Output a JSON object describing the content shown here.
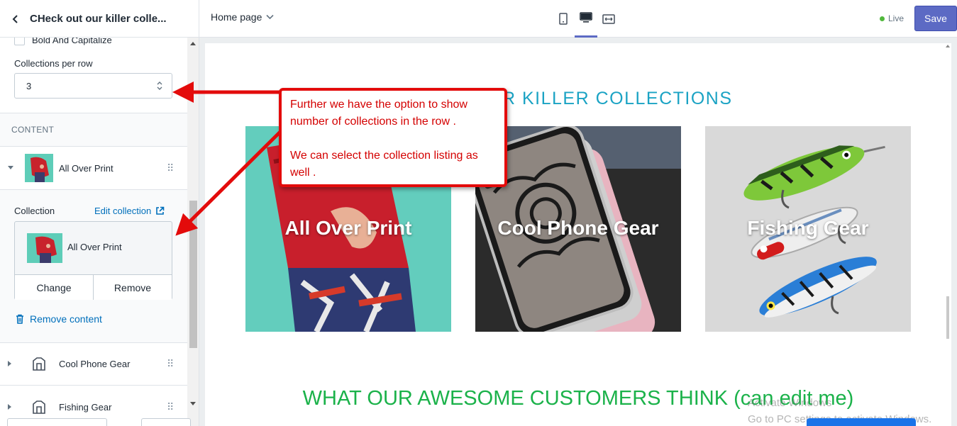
{
  "header": {
    "sidebar_title": "CHeck out our killer colle...",
    "page_selector": "Home page",
    "live_label": "Live",
    "save_label": "Save",
    "devices": [
      "mobile-icon",
      "desktop-icon",
      "fullscreen-icon"
    ]
  },
  "sidebar": {
    "checkbox_label": "Bold And Capitalize",
    "collections_per_row_label": "Collections per row",
    "collections_per_row_value": "3",
    "content_heading": "CONTENT",
    "blocks": [
      {
        "label": "All Over Print",
        "expanded": true
      },
      {
        "label": "Cool Phone Gear",
        "expanded": false
      },
      {
        "label": "Fishing Gear",
        "expanded": false
      }
    ],
    "collection_label": "Collection",
    "edit_collection_label": "Edit collection",
    "selected_collection": "All Over Print",
    "change_label": "Change",
    "remove_label": "Remove",
    "remove_content_label": "Remove content"
  },
  "preview": {
    "collections_heading": "OUR KILLER COLLECTIONS",
    "cards": [
      "All Over Print",
      "Cool Phone Gear",
      "Fishing Gear"
    ],
    "customers_heading": "WHAT OUR AWESOME CUSTOMERS THINK (can edit me)",
    "watermark_line1": "Activate Windows",
    "watermark_line2": "Go to PC settings to activate Windows."
  },
  "annotation": {
    "line1": "Further we have the option to show number of collections in the row .",
    "line2": "We can select the collection listing as well ."
  },
  "colors": {
    "accent": "#5c6ac4",
    "link": "#006fbb",
    "collections_heading": "#1ba3c4",
    "customers_heading": "#1bb24a",
    "annotation": "#e30b0b"
  }
}
